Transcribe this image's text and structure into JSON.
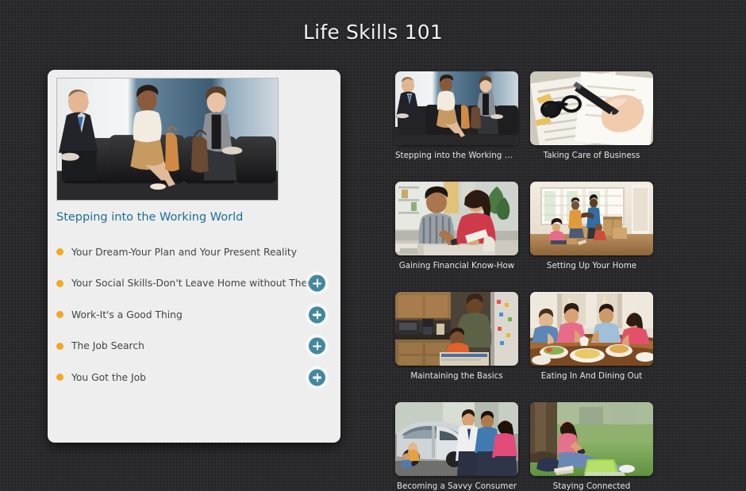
{
  "page": {
    "title": "Life Skills 101",
    "background_color": "#2b2b2d"
  },
  "feature_card": {
    "hero_image_alt": "Three job applicants in business attire seated in an office waiting room",
    "title": "Stepping into the Working World",
    "title_color": "#1d6f96",
    "bullet_color": "#f5a623",
    "button_color": "#43889e",
    "topics": [
      {
        "label": "Your Dream-Your Plan and Your Present Reality",
        "has_expand": false,
        "expand_icon": "plus-icon"
      },
      {
        "label": "Your Social Skills-Don't Leave Home without Them",
        "has_expand": true,
        "expand_icon": "plus-icon"
      },
      {
        "label": "Work-It's a Good Thing",
        "has_expand": true,
        "expand_icon": "plus-icon"
      },
      {
        "label": "The Job Search",
        "has_expand": true,
        "expand_icon": "plus-icon"
      },
      {
        "label": "You Got the Job",
        "has_expand": true,
        "expand_icon": "plus-icon"
      }
    ]
  },
  "thumbnails": [
    {
      "caption": "Stepping into the Working World",
      "scene": "office-waiting-room",
      "alt": "Three people in business suits seated in a waiting area"
    },
    {
      "caption": "Taking Care of Business",
      "scene": "paperwork-desk",
      "alt": "Eyeglasses and a hand writing on printed forms"
    },
    {
      "caption": "Gaining Financial Know-How",
      "scene": "couple-budgeting",
      "alt": "A young couple reviewing receipts and money at a table"
    },
    {
      "caption": "Setting Up Your Home",
      "scene": "family-moving-in",
      "alt": "Family unpacking cardboard boxes in a sunlit empty room"
    },
    {
      "caption": "Maintaining the Basics",
      "scene": "kitchen-father-child",
      "alt": "Father and child together in a kitchen"
    },
    {
      "caption": "Eating In And Dining Out",
      "scene": "family-dinner-table",
      "alt": "Family of four eating a meal around a dining table"
    },
    {
      "caption": "Becoming a Savvy Consumer",
      "scene": "car-shopping",
      "alt": "Family looking at a minivan with a salesperson"
    },
    {
      "caption": "Staying Connected",
      "scene": "student-laptop-park",
      "alt": "Young woman with a phone and laptop sitting on grass under a tree"
    }
  ]
}
